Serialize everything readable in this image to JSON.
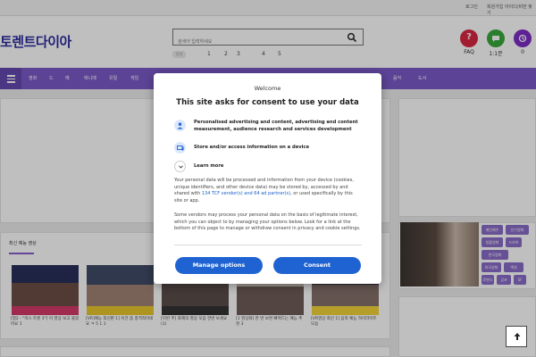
{
  "topbar": {
    "login": "로그인",
    "register": "회원가입 아이디/비번 찾기"
  },
  "header": {
    "logo": "토렌트다이아",
    "search_placeholder": "검색어 입력하세요",
    "popular_label": "인기",
    "popular_numbers": [
      "1",
      "2",
      "3",
      "4",
      "5"
    ],
    "faq_label": "FAQ",
    "qna_label": "1:1문",
    "history_label": "0"
  },
  "nav": {
    "items": [
      "영화",
      "드",
      "예",
      "애니메",
      "유틸",
      "게임",
      "음악",
      "도서"
    ]
  },
  "main": {
    "section_title": "최신 예능 영상",
    "videos": [
      {
        "title": "[정2 - \"미스 트롯 3\"] 이 영상 보고 울었어요 1"
      },
      {
        "title": "[VR]예능 최신판 1] 이건 좀 충격적이네요 ㅋ 5 1 1"
      },
      {
        "title": "[이번 주] 화제의 영상 모음 한번 보세요 (1)"
      },
      {
        "title": "[1 영상화] 한 번 보면 빠져드는 예능 추천 3"
      },
      {
        "title": "[VR영상 최신 1] 음악 예능 하이라이트 모음"
      }
    ],
    "tags": [
      "메인배우",
      "인기영화",
      "청불영화",
      "드라마",
      "한국영화",
      "외국영화",
      "액션",
      "로맨스",
      "공포",
      "SF",
      "기타"
    ]
  },
  "consent": {
    "welcome": "Welcome",
    "heading": "This site asks for consent to use your data",
    "purposes": [
      {
        "text": "Personalised advertising and content, advertising and content measurement, audience research and services development",
        "icon": "person-icon"
      },
      {
        "text": "Store and/or access information on a device",
        "icon": "device-icon"
      }
    ],
    "learn_more": "Learn more",
    "body_1a": "Your personal data will be processed and information from your device (cookies, unique identifiers, and other device data) may be stored by, accessed by and shared with ",
    "body_1_link": "134 TCF vendor(s) and 64 ad partner(s)",
    "body_1b": ", or used specifically by this site or app.",
    "body_2": "Some vendors may process your personal data on the basis of legitimate interest, which you can object to by managing your options below. Look for a link at the bottom of this page to manage or withdraw consent in privacy and cookie settings.",
    "manage_button": "Manage options",
    "consent_button": "Consent"
  },
  "colors": {
    "brand": "#7b5ac8",
    "logo": "#2b2ba0",
    "button": "#1f63d2",
    "faq": "#d8273f",
    "qna": "#3aa83a",
    "history": "#7c2cc4"
  }
}
